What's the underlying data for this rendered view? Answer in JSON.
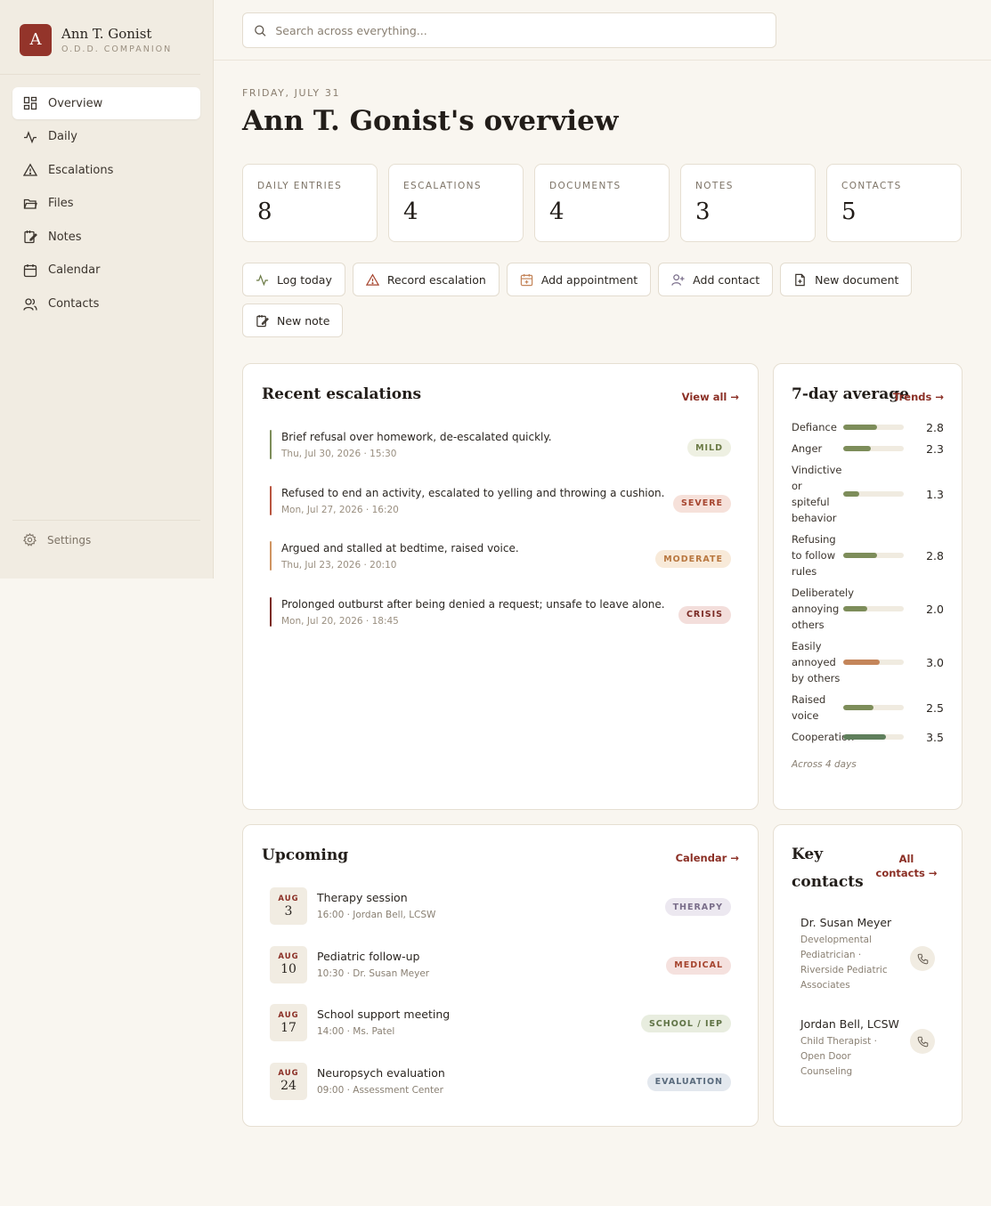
{
  "brand": {
    "initial": "A",
    "name": "Ann T. Gonist",
    "subtitle": "O.D.D. COMPANION",
    "color": "#93342a"
  },
  "nav": {
    "items": [
      {
        "label": "Overview",
        "icon": "grid-icon",
        "active": true
      },
      {
        "label": "Daily",
        "icon": "activity-icon"
      },
      {
        "label": "Escalations",
        "icon": "warning-icon"
      },
      {
        "label": "Files",
        "icon": "folder-icon"
      },
      {
        "label": "Notes",
        "icon": "note-icon"
      },
      {
        "label": "Calendar",
        "icon": "calendar-icon"
      },
      {
        "label": "Contacts",
        "icon": "users-icon"
      }
    ],
    "settings_label": "Settings"
  },
  "search": {
    "placeholder": "Search across everything...",
    "value": ""
  },
  "header": {
    "date": "FRIDAY, JULY 31",
    "title": "Ann T. Gonist's overview"
  },
  "stats": [
    {
      "label": "DAILY ENTRIES",
      "value": "8"
    },
    {
      "label": "ESCALATIONS",
      "value": "4"
    },
    {
      "label": "DOCUMENTS",
      "value": "4"
    },
    {
      "label": "NOTES",
      "value": "3"
    },
    {
      "label": "CONTACTS",
      "value": "5"
    }
  ],
  "actions": [
    {
      "label": "Log today",
      "icon": "activity-icon"
    },
    {
      "label": "Record escalation",
      "icon": "warning-icon"
    },
    {
      "label": "Add appointment",
      "icon": "calendar-plus-icon"
    },
    {
      "label": "Add contact",
      "icon": "user-plus-icon"
    },
    {
      "label": "New document",
      "icon": "file-plus-icon"
    },
    {
      "label": "New note",
      "icon": "note-icon"
    }
  ],
  "escalations": {
    "title": "Recent escalations",
    "link": "View all →",
    "items": [
      {
        "text": "Brief refusal over homework, de-escalated quickly.",
        "meta": "Thu, Jul 30, 2026 · 15:30",
        "level": "MILD",
        "bar": "#7d8d5a",
        "pill_bg": "#eef0e2",
        "pill_fg": "#6b7a45"
      },
      {
        "text": "Refused to end an activity, escalated to yelling and throwing a cushion.",
        "meta": "Mon, Jul 27, 2026 · 16:20",
        "level": "SEVERE",
        "bar": "#b8553f",
        "pill_bg": "#f6e1da",
        "pill_fg": "#a6452f"
      },
      {
        "text": "Argued and stalled at bedtime, raised voice.",
        "meta": "Thu, Jul 23, 2026 · 20:10",
        "level": "MODERATE",
        "bar": "#cf9461",
        "pill_bg": "#f8ead9",
        "pill_fg": "#b8773f"
      },
      {
        "text": "Prolonged outburst after being denied a request; unsafe to leave alone.",
        "meta": "Mon, Jul 20, 2026 · 18:45",
        "level": "CRISIS",
        "bar": "#7a2a24",
        "pill_bg": "#f3dedb",
        "pill_fg": "#7a2a24"
      }
    ]
  },
  "averages": {
    "title": "7-day average",
    "link": "Trends →",
    "max": 5,
    "items": [
      {
        "label": "Defiance",
        "value": 2.8,
        "display": "2.8",
        "color": "#7d8d5a"
      },
      {
        "label": "Anger",
        "value": 2.3,
        "display": "2.3",
        "color": "#7d8d5a"
      },
      {
        "label": "Vindictive or spiteful behavior",
        "value": 1.3,
        "display": "1.3",
        "color": "#7d8d5a"
      },
      {
        "label": "Refusing to follow rules",
        "value": 2.8,
        "display": "2.8",
        "color": "#7d8d5a"
      },
      {
        "label": "Deliberately annoying others",
        "value": 2.0,
        "display": "2.0",
        "color": "#7d8d5a"
      },
      {
        "label": "Easily annoyed by others",
        "value": 3.0,
        "display": "3.0",
        "color": "#c4855a"
      },
      {
        "label": "Raised voice",
        "value": 2.5,
        "display": "2.5",
        "color": "#7d8d5a"
      },
      {
        "label": "Cooperation",
        "value": 3.5,
        "display": "3.5",
        "color": "#5f7f5c"
      }
    ],
    "footnote": "Across 4 days"
  },
  "upcoming": {
    "title": "Upcoming",
    "link": "Calendar →",
    "items": [
      {
        "month": "AUG",
        "day": "3",
        "title": "Therapy session",
        "meta": "16:00 · Jordan Bell, LCSW",
        "tag": "THERAPY",
        "pill_bg": "#ece8f0",
        "pill_fg": "#7a6e8a"
      },
      {
        "month": "AUG",
        "day": "10",
        "title": "Pediatric follow-up",
        "meta": "10:30 · Dr. Susan Meyer",
        "tag": "MEDICAL",
        "pill_bg": "#f5e1de",
        "pill_fg": "#a6452f"
      },
      {
        "month": "AUG",
        "day": "17",
        "title": "School support meeting",
        "meta": "14:00 · Ms. Patel",
        "tag": "SCHOOL / IEP",
        "pill_bg": "#e8eddf",
        "pill_fg": "#5f7345"
      },
      {
        "month": "AUG",
        "day": "24",
        "title": "Neuropsych evaluation",
        "meta": "09:00 · Assessment Center",
        "tag": "EVALUATION",
        "pill_bg": "#e3e8ee",
        "pill_fg": "#5a6b7d"
      }
    ]
  },
  "contacts": {
    "title": "Key contacts",
    "link": "All contacts →",
    "items": [
      {
        "name": "Dr. Susan Meyer",
        "role": "Developmental Pediatrician · Riverside Pediatric Associates"
      },
      {
        "name": "Jordan Bell, LCSW",
        "role": "Child Therapist · Open Door Counseling"
      }
    ]
  }
}
